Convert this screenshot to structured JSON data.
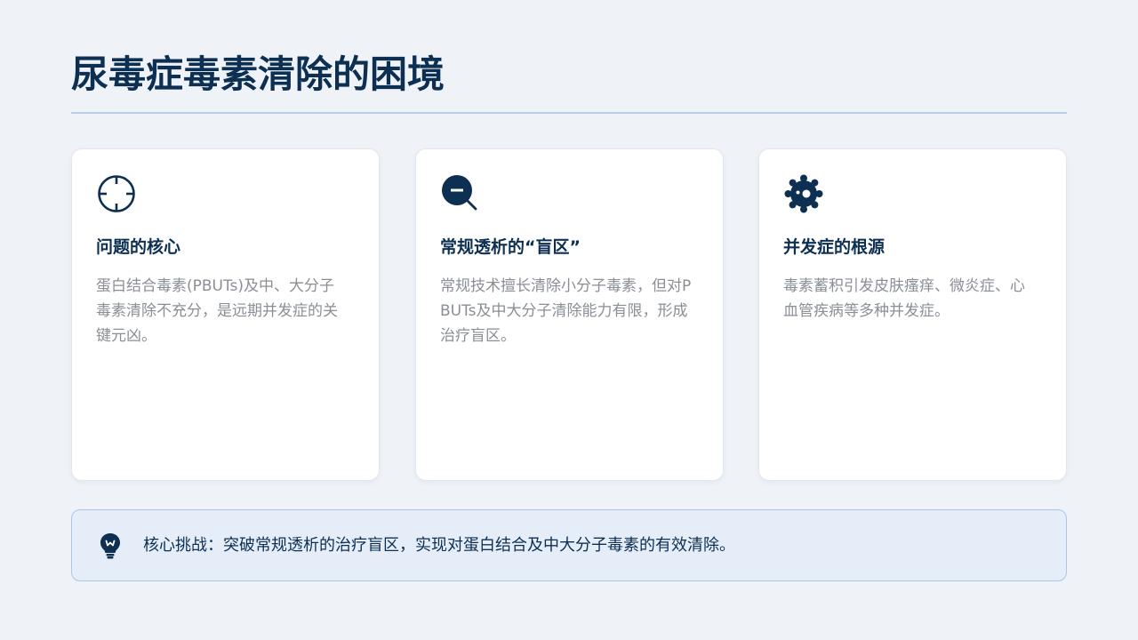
{
  "header": {
    "title": "尿毒症毒素清除的困境"
  },
  "colors": {
    "primary": "#0d2f52",
    "muted_text": "#8a8f96",
    "background": "#eff3f8",
    "callout_background": "#e4edf8",
    "callout_border": "#aec6e4"
  },
  "cards": [
    {
      "icon": "crosshair-icon",
      "title": "问题的核心",
      "body": "蛋白结合毒素(PBUTs)及中、大分子毒素清除不充分，是远期并发症的关键元凶。"
    },
    {
      "icon": "search-minus-icon",
      "title": "常规透析的“盲区”",
      "body": "常规技术擅长清除小分子毒素，但对PBUTs及中大分子清除能力有限，形成治疗盲区。"
    },
    {
      "icon": "virus-icon",
      "title": "并发症的根源",
      "body": "毒素蓄积引发皮肤瘙痒、微炎症、心血管疾病等多种并发症。"
    }
  ],
  "callout": {
    "icon": "lightbulb-icon",
    "text": "核心挑战：突破常规透析的治疗盲区，实现对蛋白结合及中大分子毒素的有效清除。"
  }
}
